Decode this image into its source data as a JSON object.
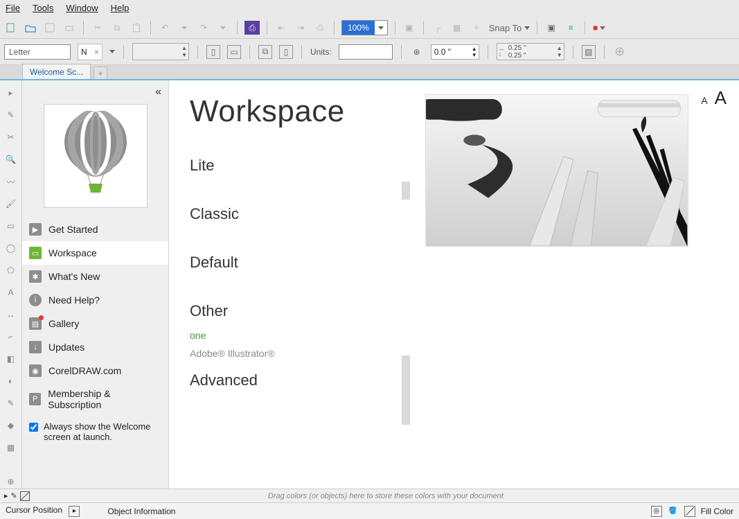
{
  "menubar": {
    "file": "File",
    "tools": "Tools",
    "window": "Window",
    "help": "Help"
  },
  "toolbar": {
    "zoom": "100%",
    "snap": "Snap To"
  },
  "propbar": {
    "paper": "Letter",
    "inline_tab_label": "N",
    "units_label": "Units:",
    "nudge_value": "0.0 \"",
    "dup_x": "0.25 \"",
    "dup_y": "0.25 \""
  },
  "tabs": {
    "welcome": "Welcome Sc..."
  },
  "sidebar": {
    "items": [
      {
        "label": "Get Started"
      },
      {
        "label": "Workspace"
      },
      {
        "label": "What's New"
      },
      {
        "label": "Need Help?"
      },
      {
        "label": "Gallery"
      },
      {
        "label": "Updates"
      },
      {
        "label": "CorelDRAW.com"
      },
      {
        "label": "Membership & Subscription"
      }
    ],
    "always_label": "Always show the Welcome screen at launch."
  },
  "page": {
    "title": "Workspace",
    "lite": "Lite",
    "classic": "Classic",
    "default": "Default",
    "other": "Other",
    "one": "one",
    "illustrator": "Adobe® Illustrator®",
    "advanced": "Advanced"
  },
  "colordock": {
    "hint": "Drag colors (or objects) here to store these colors with your document"
  },
  "status": {
    "cursor": "Cursor Position",
    "objinfo": "Object Information",
    "fill": "Fill Color"
  }
}
